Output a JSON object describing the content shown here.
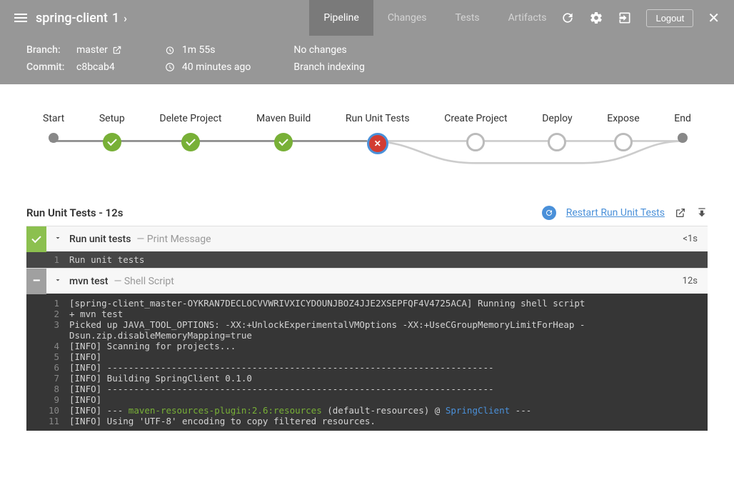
{
  "header": {
    "title": "spring-client",
    "run_number": "1",
    "tabs": [
      {
        "label": "Pipeline",
        "active": true
      },
      {
        "label": "Changes",
        "active": false
      },
      {
        "label": "Tests",
        "active": false
      },
      {
        "label": "Artifacts",
        "active": false
      }
    ],
    "logout_label": "Logout"
  },
  "subheader": {
    "branch_label": "Branch:",
    "branch_value": "master",
    "commit_label": "Commit:",
    "commit_value": "c8bcab4",
    "duration": "1m 55s",
    "age": "40 minutes ago",
    "changes_text": "No changes",
    "trigger_text": "Branch indexing"
  },
  "pipeline": {
    "stages": [
      {
        "label": "Start",
        "state": "dot"
      },
      {
        "label": "Setup",
        "state": "success"
      },
      {
        "label": "Delete Project",
        "state": "success"
      },
      {
        "label": "Maven Build",
        "state": "success"
      },
      {
        "label": "Run Unit Tests",
        "state": "fail"
      },
      {
        "label": "Create Project",
        "state": "pending"
      },
      {
        "label": "Deploy",
        "state": "pending"
      },
      {
        "label": "Expose",
        "state": "pending"
      },
      {
        "label": "End",
        "state": "dot"
      }
    ]
  },
  "section": {
    "title": "Run Unit Tests - 12s",
    "restart_label": "Restart Run Unit Tests"
  },
  "steps": [
    {
      "status": "ok",
      "name": "Run unit tests",
      "desc": "— Print Message",
      "time": "<1s",
      "log_lines": [
        {
          "n": "1",
          "t": "Run unit tests"
        }
      ],
      "log_class": "single"
    },
    {
      "status": "neutral",
      "name": "mvn test",
      "desc": "— Shell Script",
      "time": "12s",
      "log_lines": [
        {
          "n": "1",
          "t": "[spring-client_master-OYKRAN7DECLOCVVWRIVXICYDOUNJBOZ4JJE2XSEPFQF4V4725ACA] Running shell script"
        },
        {
          "n": "2",
          "t": "+ mvn test"
        },
        {
          "n": "3",
          "t": "Picked up JAVA_TOOL_OPTIONS: -XX:+UnlockExperimentalVMOptions -XX:+UseCGroupMemoryLimitForHeap -Dsun.zip.disableMemoryMapping=true"
        },
        {
          "n": "4",
          "t": "[INFO] Scanning for projects..."
        },
        {
          "n": "5",
          "t": "[INFO]"
        },
        {
          "n": "6",
          "t": "[INFO] ------------------------------------------------------------------------"
        },
        {
          "n": "7",
          "t": "[INFO] Building SpringClient 0.1.0"
        },
        {
          "n": "8",
          "t": "[INFO] ------------------------------------------------------------------------"
        },
        {
          "n": "9",
          "t": "[INFO]"
        },
        {
          "n": "10",
          "html": "[INFO] --- <span class='syn-plugin'>maven-resources-plugin:2.6:resources</span> (default-resources) @ <span class='syn-proj'>SpringClient</span> ---"
        },
        {
          "n": "11",
          "t": "[INFO] Using 'UTF-8' encoding to copy filtered resources."
        }
      ],
      "log_class": "multi"
    }
  ]
}
